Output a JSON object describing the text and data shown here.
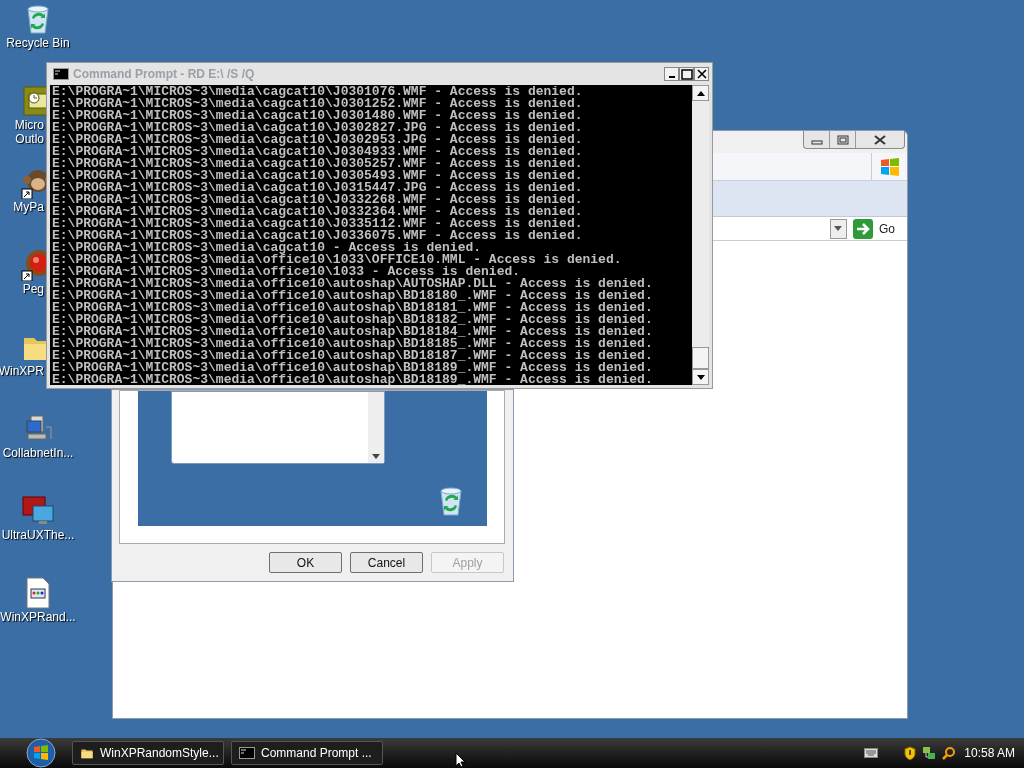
{
  "desktop_icons": [
    {
      "kind": "recycle",
      "lines": [
        "Recycle Bin"
      ]
    },
    {
      "kind": "outlook",
      "lines": [
        "Micro",
        "Outlo"
      ]
    },
    {
      "kind": "monkey",
      "lines": [
        "MyPa"
      ]
    },
    {
      "kind": "ball",
      "lines": [
        "Peg"
      ]
    },
    {
      "kind": "folder",
      "lines": [
        "WinXPR"
      ]
    },
    {
      "kind": "computer",
      "lines": [
        "CollabnetIn..."
      ]
    },
    {
      "kind": "monitor",
      "lines": [
        "UltraUXThe..."
      ]
    },
    {
      "kind": "document",
      "lines": [
        "WinXPRand..."
      ]
    }
  ],
  "explorer_window": {
    "go_button": "Go"
  },
  "dialog": {
    "buttons": [
      {
        "label": "OK",
        "disabled": false
      },
      {
        "label": "Cancel",
        "disabled": false
      },
      {
        "label": "Apply",
        "disabled": true
      }
    ]
  },
  "console_window": {
    "title": "Command Prompt - RD E:\\ /S /Q",
    "lines": [
      "E:\\PROGRA~1\\MICROS~3\\media\\cagcat10\\J0301076.WMF - Access is denied.",
      "E:\\PROGRA~1\\MICROS~3\\media\\cagcat10\\J0301252.WMF - Access is denied.",
      "E:\\PROGRA~1\\MICROS~3\\media\\cagcat10\\J0301480.WMF - Access is denied.",
      "E:\\PROGRA~1\\MICROS~3\\media\\cagcat10\\J0302827.JPG - Access is denied.",
      "E:\\PROGRA~1\\MICROS~3\\media\\cagcat10\\J0302953.JPG - Access is denied.",
      "E:\\PROGRA~1\\MICROS~3\\media\\cagcat10\\J0304933.WMF - Access is denied.",
      "E:\\PROGRA~1\\MICROS~3\\media\\cagcat10\\J0305257.WMF - Access is denied.",
      "E:\\PROGRA~1\\MICROS~3\\media\\cagcat10\\J0305493.WMF - Access is denied.",
      "E:\\PROGRA~1\\MICROS~3\\media\\cagcat10\\J0315447.JPG - Access is denied.",
      "E:\\PROGRA~1\\MICROS~3\\media\\cagcat10\\J0332268.WMF - Access is denied.",
      "E:\\PROGRA~1\\MICROS~3\\media\\cagcat10\\J0332364.WMF - Access is denied.",
      "E:\\PROGRA~1\\MICROS~3\\media\\cagcat10\\J0335112.WMF - Access is denied.",
      "E:\\PROGRA~1\\MICROS~3\\media\\cagcat10\\J0336075.WMF - Access is denied.",
      "E:\\PROGRA~1\\MICROS~3\\media\\cagcat10 - Access is denied.",
      "E:\\PROGRA~1\\MICROS~3\\media\\office10\\1033\\OFFICE10.MML - Access is denied.",
      "E:\\PROGRA~1\\MICROS~3\\media\\office10\\1033 - Access is denied.",
      "E:\\PROGRA~1\\MICROS~3\\media\\office10\\autoshap\\AUTOSHAP.DLL - Access is denied.",
      "E:\\PROGRA~1\\MICROS~3\\media\\office10\\autoshap\\BD18180_.WMF - Access is denied.",
      "E:\\PROGRA~1\\MICROS~3\\media\\office10\\autoshap\\BD18181_.WMF - Access is denied.",
      "E:\\PROGRA~1\\MICROS~3\\media\\office10\\autoshap\\BD18182_.WMF - Access is denied.",
      "E:\\PROGRA~1\\MICROS~3\\media\\office10\\autoshap\\BD18184_.WMF - Access is denied.",
      "E:\\PROGRA~1\\MICROS~3\\media\\office10\\autoshap\\BD18185_.WMF - Access is denied.",
      "E:\\PROGRA~1\\MICROS~3\\media\\office10\\autoshap\\BD18187_.WMF - Access is denied.",
      "E:\\PROGRA~1\\MICROS~3\\media\\office10\\autoshap\\BD18189_.WMF - Access is denied.",
      "E:\\PROGRA~1\\MICROS~3\\media\\office10\\autoshap\\BD18189_.WMF - Access is denied."
    ]
  },
  "taskbar": {
    "tasks": [
      {
        "kind": "folder",
        "label": "WinXPRandomStyle..."
      },
      {
        "kind": "console",
        "label": "Command Prompt ..."
      }
    ],
    "clock": "10:58 AM"
  }
}
